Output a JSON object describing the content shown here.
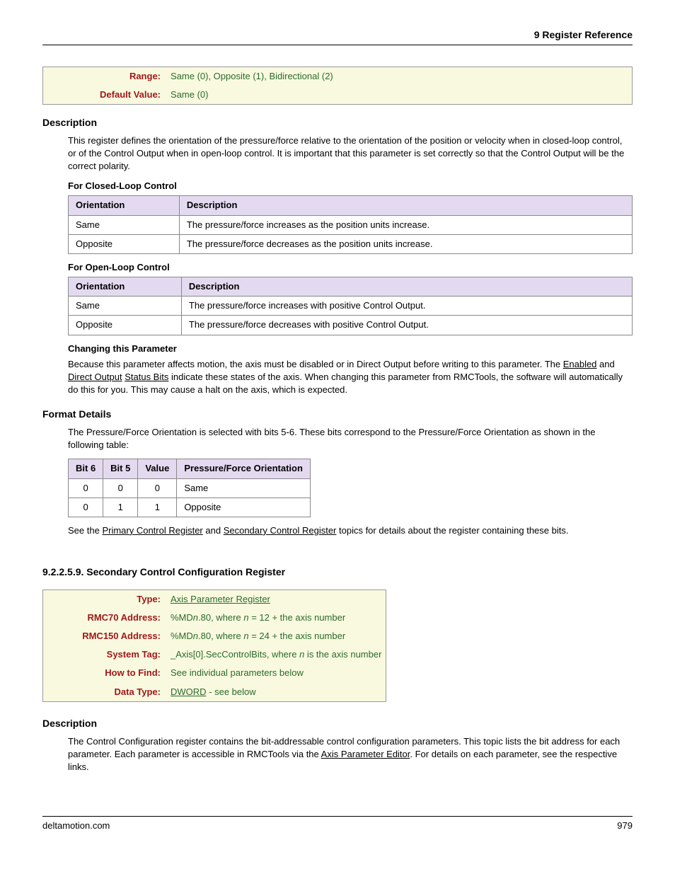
{
  "header": {
    "title": "9  Register Reference"
  },
  "box1": {
    "range_label": "Range:",
    "range_value": "Same (0), Opposite (1), Bidirectional (2)",
    "default_label": "Default Value:",
    "default_value": "Same (0)"
  },
  "desc1": {
    "heading": "Description",
    "para": "This register defines the orientation of the pressure/force relative to the orientation of the position or velocity when in closed-loop control, or of the Control Output when in open-loop control. It is important that this parameter is set correctly so that the Control Output will be the correct polarity.",
    "closed_heading": "For Closed-Loop Control",
    "closed_table": {
      "h1": "Orientation",
      "h2": "Description",
      "rows": [
        {
          "o": "Same",
          "d": "The pressure/force increases as the position units increase."
        },
        {
          "o": "Opposite",
          "d": "The pressure/force decreases as the position units increase."
        }
      ]
    },
    "open_heading": "For Open-Loop Control",
    "open_table": {
      "h1": "Orientation",
      "h2": "Description",
      "rows": [
        {
          "o": "Same",
          "d": "The pressure/force increases with positive Control Output."
        },
        {
          "o": "Opposite",
          "d": "The pressure/force decreases with positive Control Output."
        }
      ]
    },
    "changing_heading": "Changing this Parameter",
    "changing_pre": "Because this parameter affects motion, the axis must be disabled or in Direct Output before writing to this parameter. The ",
    "changing_link1": "Enabled",
    "changing_mid1": " and ",
    "changing_link2": "Direct Output",
    "changing_mid2": " ",
    "changing_link3": "Status Bits",
    "changing_post": " indicate these states of the axis. When changing this parameter from RMCTools, the software will automatically do this for you. This may cause a halt on the axis, which is expected."
  },
  "format": {
    "heading": "Format Details",
    "para": "The Pressure/Force Orientation is selected with bits 5-6. These bits correspond to the Pressure/Force Orientation as shown in the following table:",
    "table": {
      "h": [
        "Bit 6",
        "Bit 5",
        "Value",
        "Pressure/Force Orientation"
      ],
      "rows": [
        {
          "b6": "0",
          "b5": "0",
          "v": "0",
          "o": "Same"
        },
        {
          "b6": "0",
          "b5": "1",
          "v": "1",
          "o": "Opposite"
        }
      ]
    },
    "see_pre": "See the ",
    "see_link1": "Primary Control Register",
    "see_mid": " and ",
    "see_link2": "Secondary Control Register",
    "see_post": " topics for details about the register containing these bits."
  },
  "section_title": "9.2.2.5.9. Secondary Control Configuration Register",
  "box2": {
    "type_label": "Type:",
    "type_link": "Axis Parameter Register",
    "rmc70_label": "RMC70 Address:",
    "rmc70_pre": "%MD",
    "rmc70_n": "n",
    "rmc70_mid": ".80, where ",
    "rmc70_n2": "n",
    "rmc70_post": " = 12 + the axis number",
    "rmc150_label": "RMC150 Address:",
    "rmc150_pre": "%MD",
    "rmc150_n": "n",
    "rmc150_mid": ".80, where ",
    "rmc150_n2": "n",
    "rmc150_post": " = 24 + the axis number",
    "systag_label": "System Tag:",
    "systag_pre": "_Axis[0].SecControlBits, where ",
    "systag_n": "n",
    "systag_post": " is the axis number",
    "howto_label": "How to Find:",
    "howto_value": "See individual parameters below",
    "dtype_label": "Data Type:",
    "dtype_link": "DWORD",
    "dtype_post": " - see below"
  },
  "desc2": {
    "heading": "Description",
    "pre": "The Control Configuration register contains the bit-addressable control configuration parameters. This topic lists the bit address for each parameter. Each parameter is accessible in RMCTools via the ",
    "link": "Axis Parameter Editor",
    "post": ". For details on each parameter, see the respective links."
  },
  "footer": {
    "left": "deltamotion.com",
    "right": "979"
  }
}
